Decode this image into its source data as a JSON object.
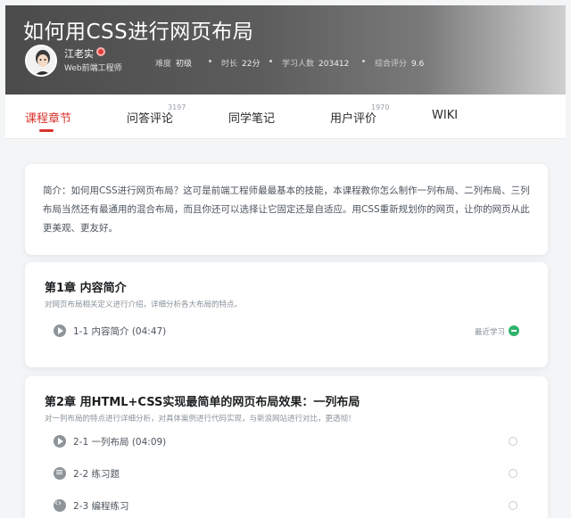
{
  "course": {
    "title": "如何用CSS进行网页布局",
    "author_name": "江老实",
    "author_title": "Web前端工程师",
    "meta": [
      {
        "key": "难度",
        "value": "初级"
      },
      {
        "key": "时长",
        "value": "22分"
      },
      {
        "key": "学习人数",
        "value": "203412"
      },
      {
        "key": "综合评分",
        "value": "9.6"
      }
    ]
  },
  "tabs": [
    {
      "label": "课程章节",
      "count": ""
    },
    {
      "label": "问答评论",
      "count": "3197"
    },
    {
      "label": "同学笔记",
      "count": ""
    },
    {
      "label": "用户评价",
      "count": "1970"
    },
    {
      "label": "WIKI",
      "count": ""
    }
  ],
  "intro": "简介：如何用CSS进行网页布局？这可是前端工程师最最基本的技能，本课程教你怎么制作一列布局、二列布局、三列布局当然还有最通用的混合布局，而且你还可以选择让它固定还是自适应。用CSS重新规划你的网页，让你的网页从此更美观、更友好。",
  "chapters": [
    {
      "title": "第1章 内容简介",
      "desc": "对网页布局相关定义进行介绍，详细分析各大布局的特点。",
      "lessons": [
        {
          "icon": "play-circle-icon",
          "label": "1-1 内容简介 (04:47)",
          "status": "最近学习"
        }
      ]
    },
    {
      "title": "第2章 用HTML+CSS实现最简单的网页布局效果：一列布局",
      "desc": "对一列布局的特点进行详细分析，对具体案例进行代码实现，与新浪网站进行对比，更透彻！",
      "lessons": [
        {
          "icon": "play-circle-icon",
          "label": "2-1 一列布局 (04:09)",
          "status": ""
        },
        {
          "icon": "quiz-icon",
          "label": "2-2 练习题",
          "status": ""
        },
        {
          "icon": "code-icon",
          "label": "2-3 编程练习",
          "status": ""
        }
      ]
    }
  ],
  "colors": {
    "accent": "#d9322c",
    "recent_green": "#2fb36b",
    "background": "#f3f5f7"
  }
}
